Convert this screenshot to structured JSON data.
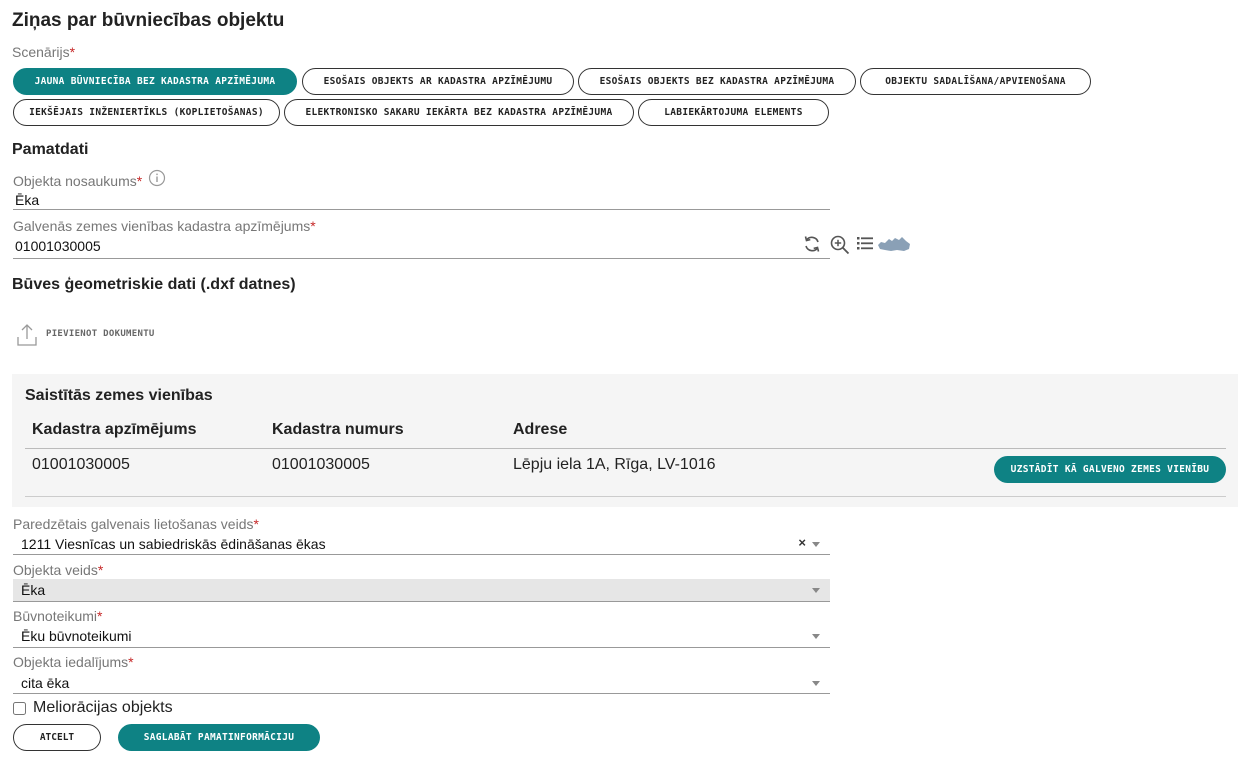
{
  "page_title": "Ziņas par būvniecības objektu",
  "scenario": {
    "label": "Scenārijs",
    "required": "*",
    "options": [
      "JAUNA BŪVNIECĪBA BEZ KADASTRA APZĪMĒJUMA",
      "ESOŠAIS OBJEKTS AR KADASTRA APZĪMĒJUMU",
      "ESOŠAIS OBJEKTS BEZ KADASTRA APZĪMĒJUMA",
      "OBJEKTU SADALĪŠANA/APVIENOŠANA",
      "IEKŠĒJAIS INŽENIERTĪKLS (KOPLIETOŠANAS)",
      "ELEKTRONISKO SAKARU IEKĀRTA BEZ KADASTRA APZĪMĒJUMA",
      "LABIEKĀRTOJUMA ELEMENTS"
    ],
    "selected_index": 0
  },
  "basic": {
    "heading": "Pamatdati",
    "object_name_label": "Objekta nosaukums",
    "object_name_value": "Ēka",
    "cadastre_label": "Galvenās zemes vienības kadastra apzīmējums",
    "cadastre_value": "01001030005",
    "required": "*"
  },
  "geometry": {
    "heading": "Būves ģeometriskie dati (.dxf datnes)",
    "upload_label": "PIEVIENOT DOKUMENTU"
  },
  "linked_land": {
    "heading": "Saistītās zemes vienības",
    "columns": [
      "Kadastra apzīmējums",
      "Kadastra numurs",
      "Adrese"
    ],
    "rows": [
      {
        "cadastre_designation": "01001030005",
        "cadastre_number": "01001030005",
        "address": "Lēpju iela 1A, Rīga, LV-1016",
        "action_label": "UZSTĀDĪT KĀ GALVENO ZEMES VIENĪBU"
      }
    ]
  },
  "fields": {
    "usage_label": "Paredzētais galvenais lietošanas veids",
    "usage_value": "1211 Viesnīcas un sabiedriskās ēdināšanas ēkas",
    "clear_symbol": "×",
    "type_label": "Objekta veids",
    "type_value": "Ēka",
    "rules_label": "Būvnoteikumi",
    "rules_value": "Ēku būvnoteikumi",
    "division_label": "Objekta iedalījums",
    "division_value": "cita ēka",
    "required": "*"
  },
  "melioration": {
    "label": "Meliorācijas objekts",
    "checked": false
  },
  "actions": {
    "cancel_label": "ATCELT",
    "save_label": "SAGLABĀT PAMATINFORMĀCIJU"
  },
  "colors": {
    "accent": "#0e8284",
    "required": "#c62828"
  }
}
